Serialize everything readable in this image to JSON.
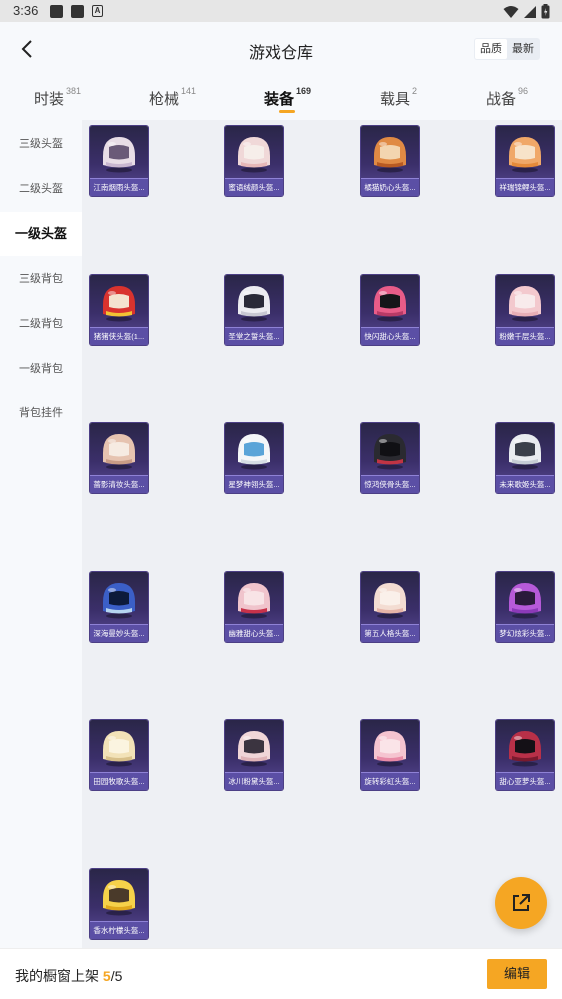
{
  "status_bar": {
    "time": "3:36",
    "notif_letter": "A"
  },
  "header": {
    "title": "游戏仓库",
    "sort_options": [
      "品质",
      "最新"
    ],
    "sort_active": 0
  },
  "tabs": [
    {
      "label": "时装",
      "count": "381",
      "active": false
    },
    {
      "label": "枪械",
      "count": "141",
      "active": false
    },
    {
      "label": "装备",
      "count": "169",
      "active": true
    },
    {
      "label": "载具",
      "count": "2",
      "active": false
    },
    {
      "label": "战备",
      "count": "96",
      "active": false
    }
  ],
  "sidebar": [
    {
      "label": "三级头盔",
      "active": false
    },
    {
      "label": "二级头盔",
      "active": false
    },
    {
      "label": "一级头盔",
      "active": true
    },
    {
      "label": "三级背包",
      "active": false
    },
    {
      "label": "二级背包",
      "active": false
    },
    {
      "label": "一级背包",
      "active": false
    },
    {
      "label": "背包挂件",
      "active": false
    }
  ],
  "items": [
    {
      "name": "江南烟雨头盔...",
      "shell": "#e8dde6",
      "accent": "#c9b7d0",
      "visor": "#6a5a78"
    },
    {
      "name": "蜜语绒颜头盔...",
      "shell": "#f0d8d8",
      "accent": "#e7b8b8",
      "visor": "#f6eeea"
    },
    {
      "name": "橘猫奶心头盔...",
      "shell": "#e08a44",
      "accent": "#b85a22",
      "visor": "#f3d5b0"
    },
    {
      "name": "祥瑞锦鲤头盔...",
      "shell": "#f0a868",
      "accent": "#e58a3a",
      "visor": "#f7e3c9"
    },
    {
      "name": "猪猪侠头盔(1...",
      "shell": "#d9332e",
      "accent": "#f2c234",
      "visor": "#f4e3cf"
    },
    {
      "name": "圣堂之誓头盔...",
      "shell": "#ececf1",
      "accent": "#c8c8d2",
      "visor": "#2a2a38"
    },
    {
      "name": "快闪甜心头盔...",
      "shell": "#e85c88",
      "accent": "#b83a66",
      "visor": "#151518"
    },
    {
      "name": "粉嫩千层头盔...",
      "shell": "#f3c9ce",
      "accent": "#e7aeb6",
      "visor": "#f8ebec"
    },
    {
      "name": "蔷影清妆头盔...",
      "shell": "#e6c3b0",
      "accent": "#c99c86",
      "visor": "#f6ebe2"
    },
    {
      "name": "星梦神翎头盔...",
      "shell": "#f4f6f8",
      "accent": "#d6dde4",
      "visor": "#5aa4d8"
    },
    {
      "name": "惊鸿侠骨头盔...",
      "shell": "#2a2a30",
      "accent": "#c03444",
      "visor": "#101014"
    },
    {
      "name": "未来歌姬头盔...",
      "shell": "#e9ecf0",
      "accent": "#c5ccd4",
      "visor": "#3a3f4a"
    },
    {
      "name": "深海曼妙头盔...",
      "shell": "#3b5fc7",
      "accent": "#b5d4f0",
      "visor": "#0d1a3a"
    },
    {
      "name": "幽雅甜心头盔...",
      "shell": "#f0c4cc",
      "accent": "#c8324a",
      "visor": "#f8e4e6"
    },
    {
      "name": "第五人格头盔...",
      "shell": "#f3dcd2",
      "accent": "#e6b4a8",
      "visor": "#faf0ea"
    },
    {
      "name": "梦幻炫彩头盔...",
      "shell": "#b65ad8",
      "accent": "#8c3ab8",
      "visor": "#2a1a3a"
    },
    {
      "name": "田园牧歌头盔...",
      "shell": "#f2e2b8",
      "accent": "#d8c08a",
      "visor": "#fbf4e0"
    },
    {
      "name": "冰川粉黛头盔...",
      "shell": "#f1d6d8",
      "accent": "#e0b4b8",
      "visor": "#3b3440"
    },
    {
      "name": "旋转彩虹头盔...",
      "shell": "#f5c4d0",
      "accent": "#e88aa6",
      "visor": "#fae4e8"
    },
    {
      "name": "甜心亚萝头盔...",
      "shell": "#b83048",
      "accent": "#7a1a2e",
      "visor": "#141016"
    },
    {
      "name": "香水柠檬头盔...",
      "shell": "#f6d24a",
      "accent": "#e0a81c",
      "visor": "#4a3a2a"
    }
  ],
  "footer": {
    "label": "我的橱窗上架",
    "current": "5",
    "total": "/5",
    "edit": "编辑"
  }
}
